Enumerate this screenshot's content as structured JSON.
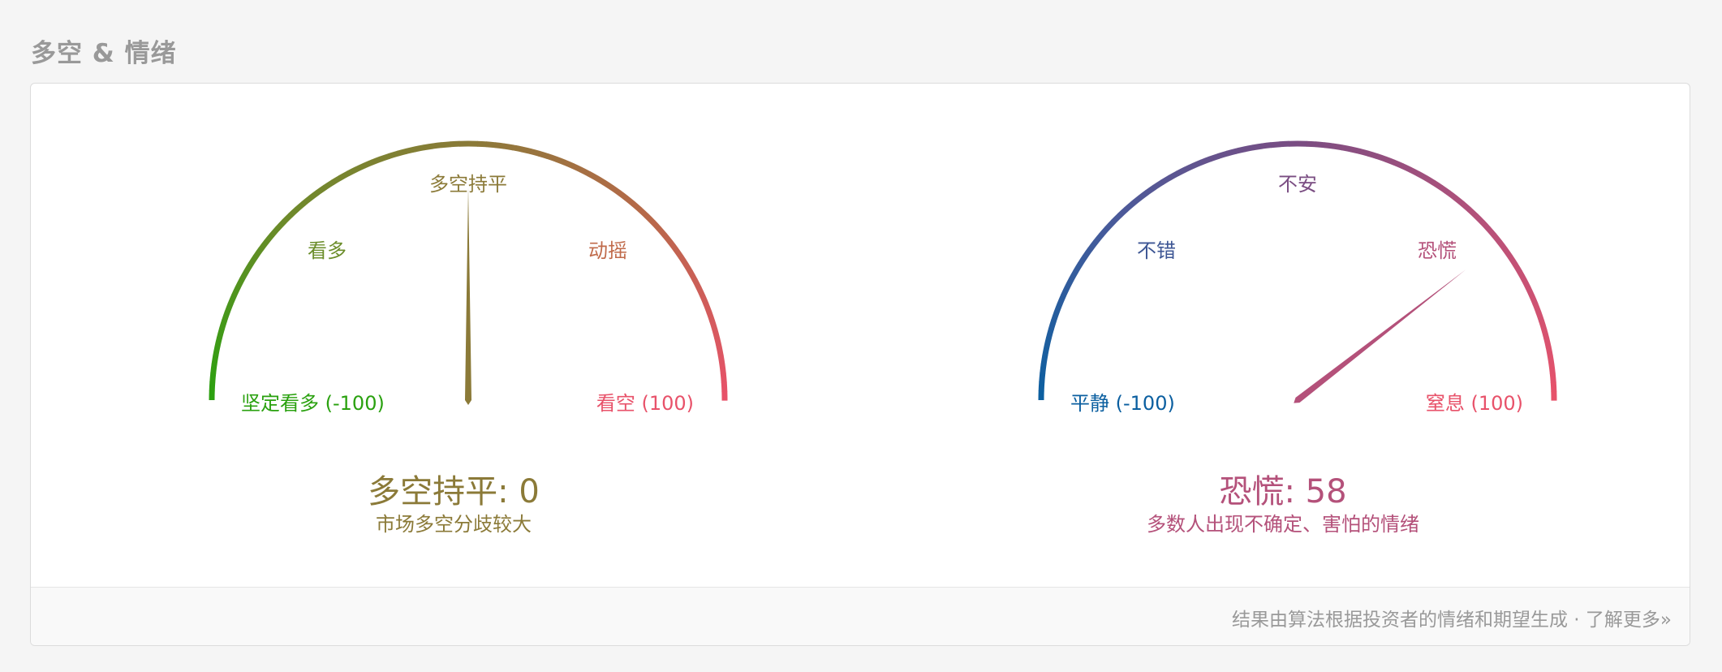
{
  "section": {
    "title": "多空 & 情绪"
  },
  "colors": {
    "green": "#2aa10f",
    "olive": "#8b7a38",
    "red": "#e8526a",
    "blue": "#0b5fa0",
    "purple": "#7a4d82",
    "pink": "#b4517a",
    "muted": "#999999"
  },
  "gauges": [
    {
      "id": "bull-bear",
      "labels": {
        "left": "看多",
        "top": "多空持平",
        "right": "动摇"
      },
      "min_label": "坚定看多 (-100)",
      "max_label": "看空 (100)",
      "min": -100,
      "max": 100,
      "value": 0,
      "status": "多空持平: 0",
      "description": "市场多空分歧较大",
      "gradient": [
        "#2aa10f",
        "#6e8a2a",
        "#8a7a38",
        "#b8684a",
        "#e8526a"
      ],
      "status_color": "#8b7a38",
      "needle_color": "#8b7a38",
      "colors": {
        "left": "#6b8d2a",
        "top": "#8b7a38",
        "right": "#c06a4a",
        "min": "#2aa10f",
        "max": "#e8526a"
      }
    },
    {
      "id": "sentiment",
      "labels": {
        "left": "不错",
        "top": "不安",
        "right": "恐慌"
      },
      "min_label": "平静 (-100)",
      "max_label": "窒息 (100)",
      "min": -100,
      "max": 100,
      "value": 58,
      "status": "恐慌: 58",
      "description": "多数人出现不确定、害怕的情绪",
      "gradient": [
        "#0b5fa0",
        "#4a5a9a",
        "#7a4d82",
        "#b4517a",
        "#e8526a"
      ],
      "status_color": "#b4517a",
      "needle_color": "#b4517a",
      "colors": {
        "left": "#3d5694",
        "top": "#7a4d82",
        "right": "#b4517a",
        "min": "#0b5fa0",
        "max": "#e8526a"
      }
    }
  ],
  "footer": {
    "text": "结果由算法根据投资者的情绪和期望生成 · ",
    "link_label": "了解更多»"
  }
}
